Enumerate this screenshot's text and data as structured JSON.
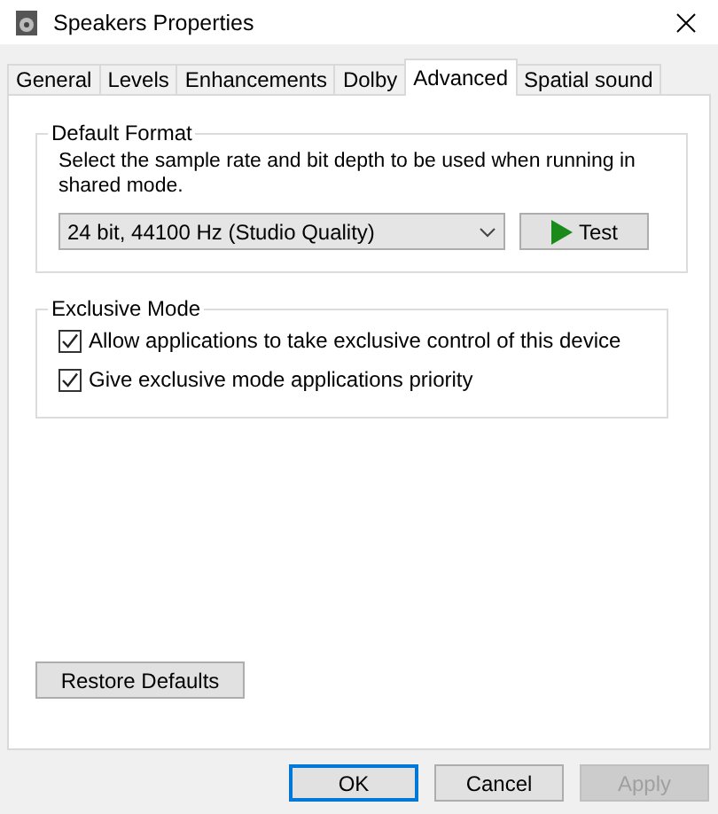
{
  "window": {
    "title": "Speakers Properties"
  },
  "tabs": [
    {
      "label": "General",
      "selected": false
    },
    {
      "label": "Levels",
      "selected": false
    },
    {
      "label": "Enhancements",
      "selected": false
    },
    {
      "label": "Dolby",
      "selected": false
    },
    {
      "label": "Advanced",
      "selected": true
    },
    {
      "label": "Spatial sound",
      "selected": false
    }
  ],
  "default_format": {
    "title": "Default Format",
    "description": "Select the sample rate and bit depth to be used when running in shared mode.",
    "format": "24 bit, 44100 Hz (Studio Quality)",
    "test_button": "Test"
  },
  "exclusive_mode": {
    "title": "Exclusive Mode",
    "options": [
      {
        "label": "Allow applications to take exclusive control of this device",
        "checked": true
      },
      {
        "label": "Give exclusive mode applications priority",
        "checked": true
      }
    ]
  },
  "restore_button": "Restore Defaults",
  "buttons": [
    {
      "label": "OK",
      "default": true,
      "disabled": false
    },
    {
      "label": "Cancel",
      "default": false,
      "disabled": false
    },
    {
      "label": "Apply",
      "default": false,
      "disabled": true
    }
  ]
}
